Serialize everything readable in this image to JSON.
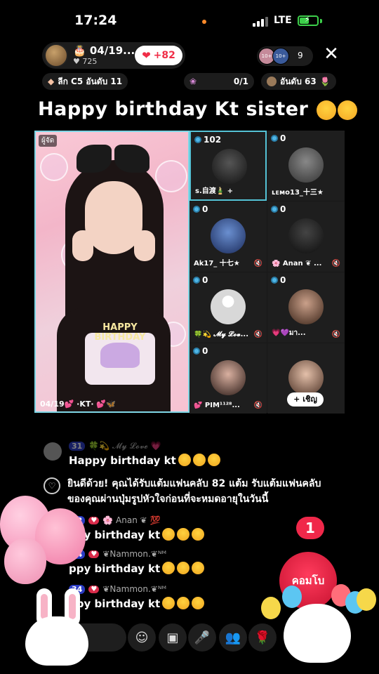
{
  "status": {
    "time": "17:24",
    "network": "LTE"
  },
  "host": {
    "name": "04/19...",
    "likes": "725",
    "follow_label": "+82"
  },
  "viewers": {
    "count": "9",
    "avatar_badges": [
      "10+",
      "10+"
    ]
  },
  "badges": {
    "league": "ลีก C5 อันดับ 11",
    "gift_goal": "0/1",
    "rank": "อันดับ 63"
  },
  "title": "Happy birthday Kt sister",
  "host_tile": {
    "tag": "ผู้จัด",
    "cake_text": "HAPPY BIRTHDAY",
    "caption": "04/19💕 ·KT· 💕🦋"
  },
  "seats": [
    {
      "score": "102",
      "name": "s.自渡🎍 +",
      "active": true
    },
    {
      "score": "0",
      "name": "ʟᴇᴍᴏ13_十三★",
      "active": false
    },
    {
      "score": "0",
      "name": "Ak17_ 十七★",
      "active": false
    },
    {
      "score": "0",
      "name": "🌸 Anan ❦ ...",
      "active": false
    },
    {
      "score": "0",
      "name": "🍀💫 𝓜𝔂 𝓛𝓸𝓿...",
      "active": false
    },
    {
      "score": "0",
      "name": "💗💜มา...",
      "active": false
    },
    {
      "score": "0",
      "name": "💕 PIM¹¹²⁸...",
      "active": false
    },
    {
      "score": "",
      "name": "",
      "invite_label": "+ เชิญ",
      "active": false
    }
  ],
  "chat": {
    "messages": [
      {
        "meta_level": "31",
        "meta_name": "🍀💫 𝓜𝔂 𝓛𝓸𝓿𝓮 💗",
        "text": "Happy birthday kt"
      },
      {
        "meta_level": "32",
        "meta_name": "🌸 Anan ❦ 💯",
        "text": "ppy birthday kt"
      },
      {
        "meta_level": "34",
        "meta_name": "❦Nammon.❦ᴺᴹ",
        "text": "ppy birthday kt"
      },
      {
        "meta_level": "34",
        "meta_name": "❦Nammon.❦ᴺᴹ",
        "text": "ppy birthday kt"
      }
    ],
    "system_message": "ยินดีด้วย! คุณได้รับแต้มแฟนคลับ 82 แต้ม รับแต้มแฟนคลับของคุณผ่านปุ่มรูปหัวใจก่อนที่จะหมดอายุในวันนี้"
  },
  "combo": {
    "count": "1",
    "label": "คอมโบ"
  },
  "colors": {
    "accent": "#f02d47",
    "seat_border": "#55c3d6",
    "host_border": "#7fd7e6"
  },
  "icons": [
    "heart-icon",
    "close-icon",
    "smile-icon",
    "camera-off-icon",
    "mic-icon",
    "people-icon",
    "rose-gift-icon"
  ]
}
